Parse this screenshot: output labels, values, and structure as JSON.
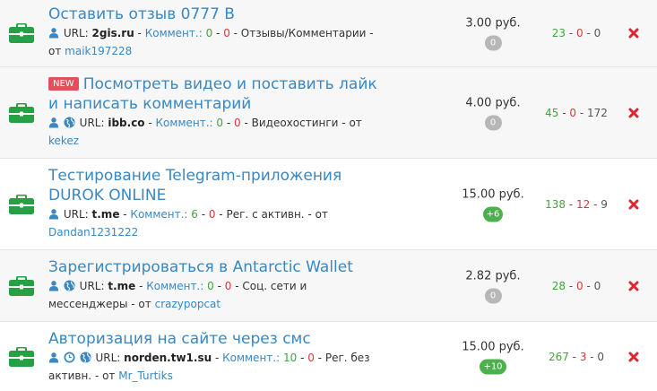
{
  "labels": {
    "url": "URL:",
    "comments": "Коммент.:",
    "from": "от",
    "currency": "руб."
  },
  "colors": {
    "link": "#3a87c2",
    "green": "#3ea53e",
    "red": "#d23a3a",
    "new_badge": "#e4505a"
  },
  "tasks": [
    {
      "title": "Оставить отзыв 0777 В",
      "is_new": false,
      "url": "2gis.ru",
      "comments_pos": "0",
      "comments_neg": "0",
      "category": "Отзывы/Комментарии",
      "author": "maik197228",
      "price": "3.00 руб.",
      "badge": "0",
      "stat_green": "23",
      "stat_red": "0",
      "stat_gray": "0"
    },
    {
      "title": "Посмотреть видео и поставить лайк и написать комментарий",
      "is_new": true,
      "new_label": "NEW",
      "url": "ibb.co",
      "comments_pos": "0",
      "comments_neg": "0",
      "category": "Видеохостинги",
      "author": "kekez",
      "price": "4.00 руб.",
      "badge": "0",
      "stat_green": "45",
      "stat_red": "0",
      "stat_gray": "172"
    },
    {
      "title": "Тестирование Telegram-приложения DUROK ONLINE",
      "is_new": false,
      "url": "t.me",
      "comments_pos": "6",
      "comments_neg": "0",
      "category": "Рег. с активн.",
      "author": "Dandan1231222",
      "price": "15.00 руб.",
      "badge": "+6",
      "stat_green": "138",
      "stat_red": "12",
      "stat_gray": "9"
    },
    {
      "title": "Зарегистрироваться в Antarctic Wallet",
      "is_new": false,
      "url": "t.me",
      "comments_pos": "0",
      "comments_neg": "0",
      "category": "Соц. сети и мессенджеры",
      "author": "crazypopcat",
      "price": "2.82 руб.",
      "badge": "0",
      "stat_green": "28",
      "stat_red": "0",
      "stat_gray": "0"
    },
    {
      "title": "Авторизация на сайте через смс",
      "is_new": false,
      "url": "norden.tw1.su",
      "comments_pos": "10",
      "comments_neg": "0",
      "category": "Рег. без активн.",
      "author": "Mr_Turtiks",
      "price": "15.00 руб.",
      "badge": "+10",
      "stat_green": "267",
      "stat_red": "3",
      "stat_gray": "0"
    }
  ]
}
